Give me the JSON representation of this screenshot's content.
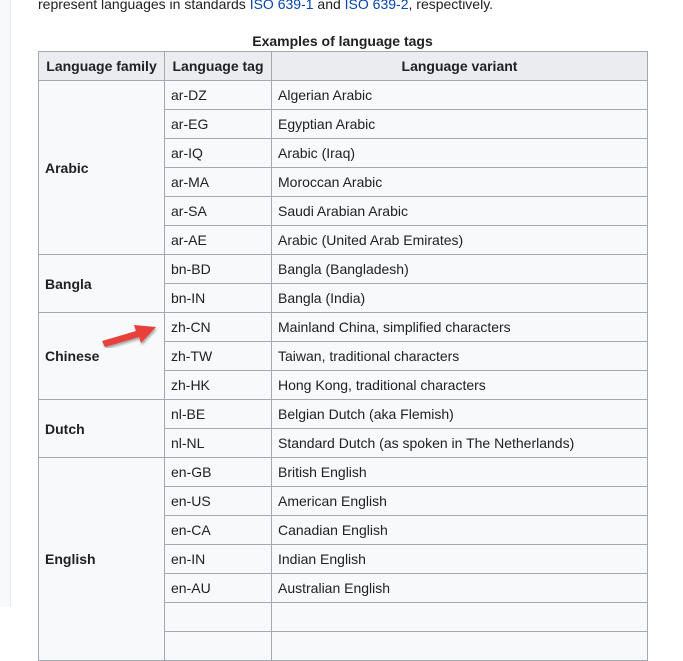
{
  "intro": {
    "text_before": "represent languages in standards ",
    "link1": "ISO 639-1",
    "text_middle": " and ",
    "link2": "ISO 639-2",
    "text_after": ", respectively."
  },
  "table": {
    "caption": "Examples of language tags",
    "headers": [
      "Language family",
      "Language tag",
      "Language variant"
    ],
    "groups": [
      {
        "family": "Arabic",
        "rows": [
          {
            "tag": "ar-DZ",
            "variant": "Algerian Arabic"
          },
          {
            "tag": "ar-EG",
            "variant": "Egyptian Arabic"
          },
          {
            "tag": "ar-IQ",
            "variant": "Arabic (Iraq)"
          },
          {
            "tag": "ar-MA",
            "variant": "Moroccan Arabic"
          },
          {
            "tag": "ar-SA",
            "variant": "Saudi Arabian Arabic"
          },
          {
            "tag": "ar-AE",
            "variant": "Arabic (United Arab Emirates)"
          }
        ]
      },
      {
        "family": "Bangla",
        "rows": [
          {
            "tag": "bn-BD",
            "variant": "Bangla (Bangladesh)"
          },
          {
            "tag": "bn-IN",
            "variant": "Bangla (India)"
          }
        ]
      },
      {
        "family": "Chinese",
        "rows": [
          {
            "tag": "zh-CN",
            "variant": "Mainland China, simplified characters"
          },
          {
            "tag": "zh-TW",
            "variant": "Taiwan, traditional characters"
          },
          {
            "tag": "zh-HK",
            "variant": "Hong Kong, traditional characters"
          }
        ]
      },
      {
        "family": "Dutch",
        "rows": [
          {
            "tag": "nl-BE",
            "variant": "Belgian Dutch (aka Flemish)"
          },
          {
            "tag": "nl-NL",
            "variant": "Standard Dutch (as spoken in The Netherlands)"
          }
        ]
      },
      {
        "family": "English",
        "rows": [
          {
            "tag": "en-GB",
            "variant": "British English"
          },
          {
            "tag": "en-US",
            "variant": "American English"
          },
          {
            "tag": "en-CA",
            "variant": "Canadian English"
          },
          {
            "tag": "en-IN",
            "variant": "Indian English"
          },
          {
            "tag": "en-AU",
            "variant": "Australian English"
          },
          {
            "tag": "",
            "variant": ""
          },
          {
            "tag": "",
            "variant": ""
          }
        ]
      }
    ]
  },
  "annotation": {
    "arrow_icon": "red-arrow-icon",
    "arrow_color": "#e8413b"
  },
  "colors": {
    "link": "#0645ad",
    "header_bg": "#eaecf0",
    "cell_bg": "#f8f9fa",
    "border": "#a2a9b1"
  }
}
